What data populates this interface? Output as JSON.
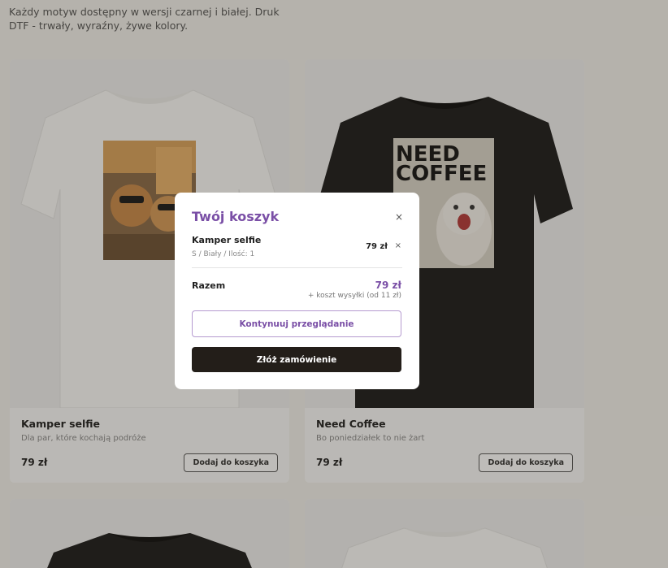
{
  "intro_text": "Każdy motyw dostępny w wersji czarnej i białej. Druk DTF - trwały, wyraźny, żywe kolory.",
  "products": [
    {
      "name": "Kamper selfie",
      "description": "Dla par, które kochają podróże",
      "price": "79 zł",
      "add_label": "Dodaj do koszyka",
      "shirt_color": "white"
    },
    {
      "name": "Need Coffee",
      "description": "Bo poniedziałek to nie żart",
      "price": "79 zł",
      "add_label": "Dodaj do koszyka",
      "shirt_color": "black",
      "print_text_1": "NEED",
      "print_text_2": "COFFEE"
    },
    {
      "shirt_color": "black"
    },
    {
      "shirt_color": "white"
    }
  ],
  "cart": {
    "title": "Twój koszyk",
    "close_icon": "×",
    "items": [
      {
        "name": "Kamper selfie",
        "variant": "S / Biały / Ilość: 1",
        "price": "79 zł",
        "remove_icon": "×"
      }
    ],
    "total_label": "Razem",
    "total_value": "79 zł",
    "shipping_note": "+ koszt wysyłki (od 11 zł)",
    "continue_label": "Kontynuuj przeglądanie",
    "checkout_label": "Złóż zamówienie"
  },
  "colors": {
    "accent": "#7a4fa6",
    "dark_button": "#231e19",
    "overlay": "rgba(40,34,22,0.30)",
    "page_bg": "#f2f1ec"
  }
}
